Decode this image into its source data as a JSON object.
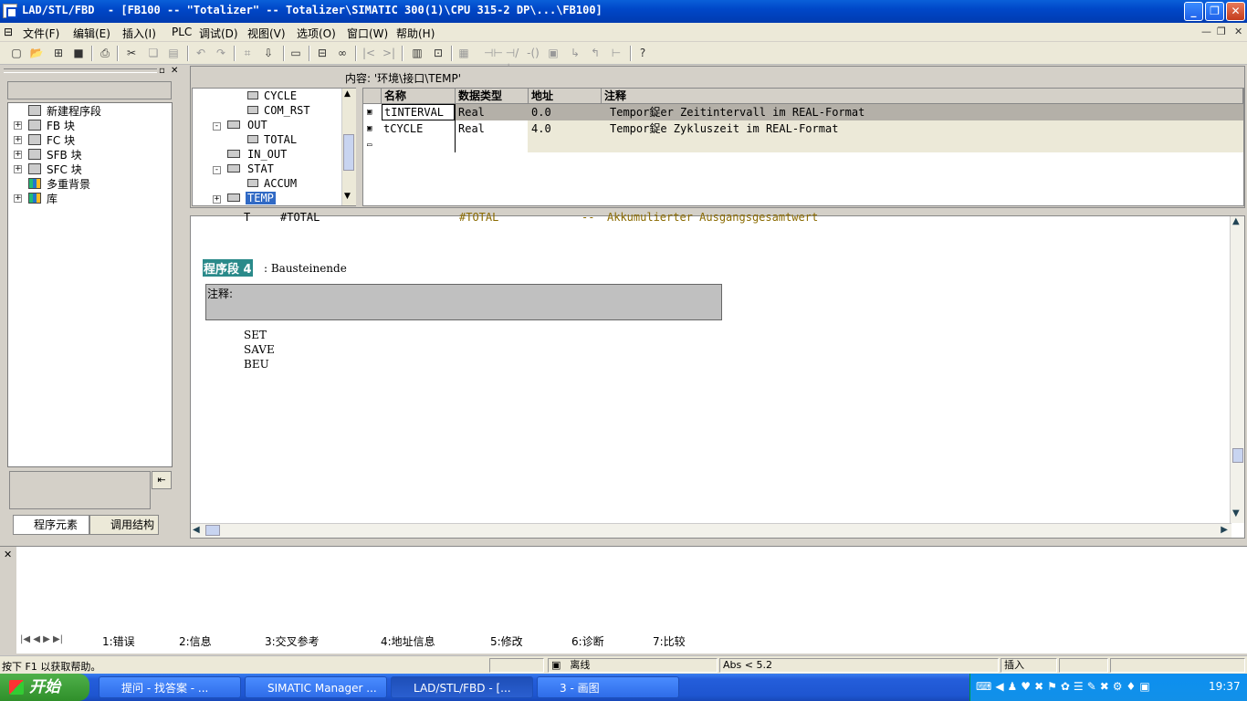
{
  "window": {
    "title": "LAD/STL/FBD  - [FB100 -- \"Totalizer\" -- Totalizer\\SIMATIC 300(1)\\CPU 315-2 DP\\...\\FB100]"
  },
  "menu": [
    "文件(F)",
    "编辑(E)",
    "插入(I)",
    "PLC",
    "调试(D)",
    "视图(V)",
    "选项(O)",
    "窗口(W)",
    "帮助(H)"
  ],
  "left_tree": [
    {
      "label": "新建程序段",
      "expander": ""
    },
    {
      "label": "FB 块",
      "expander": "+"
    },
    {
      "label": "FC 块",
      "expander": "+"
    },
    {
      "label": "SFB 块",
      "expander": "+"
    },
    {
      "label": "SFC 块",
      "expander": "+"
    },
    {
      "label": "多重背景",
      "expander": ""
    },
    {
      "label": "库",
      "expander": "+"
    }
  ],
  "left_tabs": [
    "程序元素",
    "调用结构"
  ],
  "interface": {
    "content_label": "内容:  '环境\\接口\\TEMP'",
    "tree": [
      {
        "label": "CYCLE",
        "level": 2,
        "expander": ""
      },
      {
        "label": "COM_RST",
        "level": 2,
        "expander": ""
      },
      {
        "label": "OUT",
        "level": 1,
        "expander": "-"
      },
      {
        "label": "TOTAL",
        "level": 2,
        "expander": ""
      },
      {
        "label": "IN_OUT",
        "level": 1,
        "expander": ""
      },
      {
        "label": "STAT",
        "level": 1,
        "expander": "-"
      },
      {
        "label": "ACCUM",
        "level": 2,
        "expander": ""
      },
      {
        "label": "TEMP",
        "level": 1,
        "expander": "+",
        "selected": true
      }
    ],
    "columns": [
      "名称",
      "数据类型",
      "地址",
      "注释"
    ],
    "rows": [
      {
        "name": "tINTERVAL",
        "type": "Real",
        "address": "0.0",
        "comment": "Tempor鋜er Zeitintervall im REAL-Format",
        "selected": true
      },
      {
        "name": "tCYCLE",
        "type": "Real",
        "address": "4.0",
        "comment": "Tempor鋜e Zykluszeit im REAL-Format"
      }
    ]
  },
  "code": {
    "prev_line": {
      "pin": "T",
      "operand": "#TOTAL",
      "actual": "#TOTAL",
      "sep": "--",
      "comment": "Akkumulierter Ausgangsgesamtwert"
    },
    "network_label": "程序段 4",
    "network_title": ": Bausteinende",
    "comment_label": "注释:",
    "stl": [
      "SET",
      "SAVE",
      "BEU"
    ]
  },
  "bottom_tabs": [
    "1:错误",
    "2:信息",
    "3:交叉参考",
    "4:地址信息",
    "5:修改",
    "6:诊断",
    "7:比较"
  ],
  "status": {
    "help": "按下 F1 以获取帮助。",
    "mode": "离线",
    "abs": "Abs < 5.2",
    "insert": "插入"
  },
  "taskbar": {
    "start": "开始",
    "buttons": [
      "提问 - 找答案 - ...",
      "SIMATIC Manager ...",
      "LAD/STL/FBD  - [...",
      "3 - 画图"
    ],
    "clock": "19:37"
  }
}
